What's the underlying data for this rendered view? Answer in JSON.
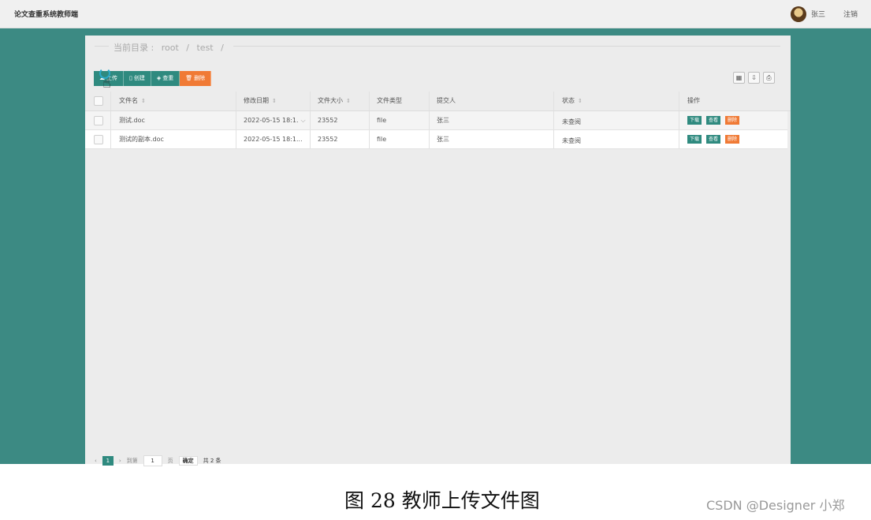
{
  "app": {
    "title": "论文查重系统教师端"
  },
  "user": {
    "name": "张三",
    "logout_label": "注销"
  },
  "breadcrumb": {
    "label": "当前目录 :",
    "parts": [
      "root",
      "/",
      "test",
      "/"
    ]
  },
  "toolbar": {
    "upload": "上传",
    "create": "创建",
    "review": "查重",
    "delete": "删除",
    "colors": {
      "primary": "#2f8a7f",
      "danger": "#f07a35"
    }
  },
  "right_tools": {
    "icons": [
      "columns-icon",
      "export-icon",
      "print-icon"
    ]
  },
  "table": {
    "headers": [
      "文件名",
      "修改日期",
      "文件大小",
      "文件类型",
      "提交人",
      "状态",
      "操作"
    ],
    "rows": [
      {
        "name": "测试.doc",
        "date": "2022-05-15 18:1.",
        "size": "23552",
        "type": "file",
        "submitter": "张三",
        "status": "未查阅"
      },
      {
        "name": "测试的副本.doc",
        "date": "2022-05-15 18:1...",
        "size": "23552",
        "type": "file",
        "submitter": "张三",
        "status": "未查阅"
      }
    ],
    "actions": {
      "download": "下载",
      "view": "查看",
      "delete": "删除"
    }
  },
  "pagination": {
    "prev": "‹",
    "current": "1",
    "next": "›",
    "goto": "到第",
    "page_input": "1",
    "page_unit": "页",
    "confirm": "确定",
    "total": "共 2 条"
  },
  "caption": "图 28 教师上传文件图",
  "watermark": "CSDN @Designer 小郑",
  "colors": {
    "header_teal": "#3c8a83"
  }
}
